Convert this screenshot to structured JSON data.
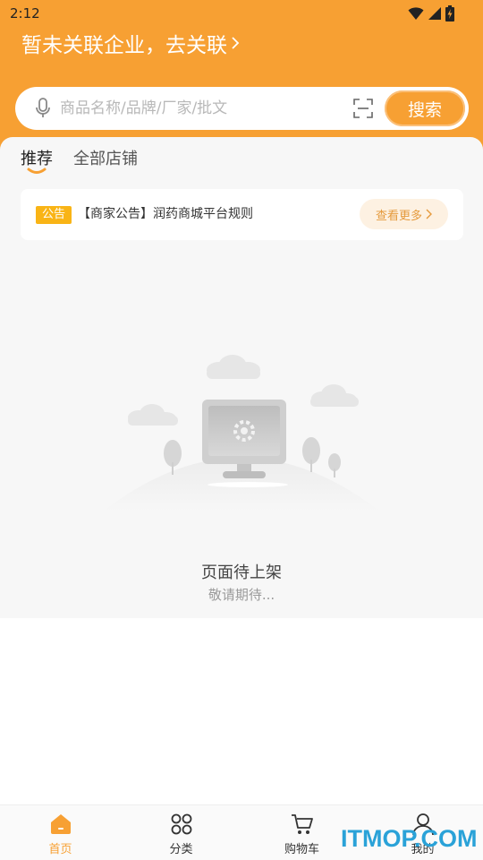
{
  "status_bar": {
    "time": "2:12"
  },
  "header": {
    "enterprise_link": "暂未关联企业，去关联"
  },
  "search": {
    "placeholder": "商品名称/品牌/厂家/批文",
    "value": "",
    "button_label": "搜索"
  },
  "tabs": [
    {
      "label": "推荐",
      "active": true
    },
    {
      "label": "全部店铺",
      "active": false
    }
  ],
  "notice": {
    "badge": "公告",
    "text": "【商家公告】润药商城平台规则",
    "more_label": "查看更多"
  },
  "empty_state": {
    "title": "页面待上架",
    "subtitle": "敬请期待..."
  },
  "tabbar": [
    {
      "label": "首页",
      "icon": "home-icon",
      "active": true
    },
    {
      "label": "分类",
      "icon": "category-icon",
      "active": false
    },
    {
      "label": "购物车",
      "icon": "cart-icon",
      "active": false
    },
    {
      "label": "我的",
      "icon": "user-icon",
      "active": false
    }
  ],
  "watermark": "ITMOP.COM",
  "colors": {
    "brand": "#f7a033",
    "notice_badge": "#f9b416",
    "more_button_bg": "#fdf1e2",
    "watermark": "#2aa2d8"
  }
}
